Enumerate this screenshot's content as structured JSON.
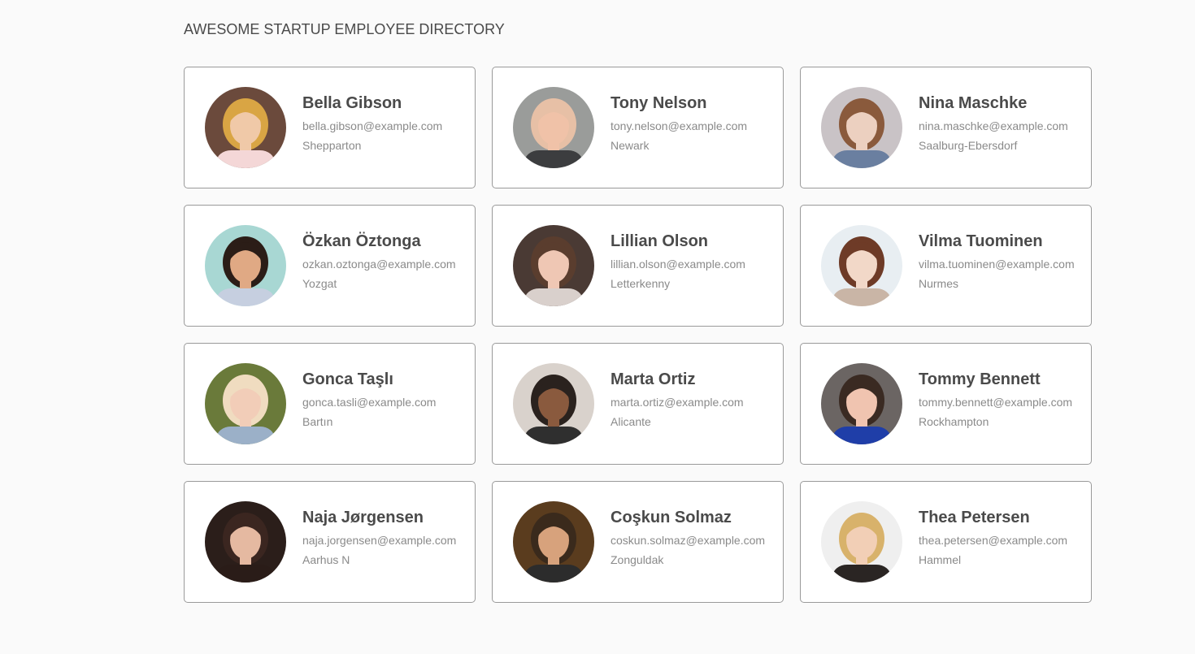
{
  "page": {
    "title": "AWESOME STARTUP EMPLOYEE DIRECTORY"
  },
  "employees": [
    {
      "name": "Bella Gibson",
      "email": "bella.gibson@example.com",
      "city": "Shepparton",
      "avatar": {
        "bg": "#6b4a3c",
        "hair": "#d9a544",
        "skin": "#f0c9a8",
        "shirt": "#f4d7d7"
      }
    },
    {
      "name": "Tony Nelson",
      "email": "tony.nelson@example.com",
      "city": "Newark",
      "avatar": {
        "bg": "#9a9c9a",
        "hair": "#e7c0a6",
        "skin": "#f0c2a8",
        "shirt": "#3c3d3f"
      }
    },
    {
      "name": "Nina Maschke",
      "email": "nina.maschke@example.com",
      "city": "Saalburg-Ebersdorf",
      "avatar": {
        "bg": "#c9c3c6",
        "hair": "#8a5a3c",
        "skin": "#ecd0c0",
        "shirt": "#6a7fa0"
      }
    },
    {
      "name": "Özkan Öztonga",
      "email": "ozkan.oztonga@example.com",
      "city": "Yozgat",
      "avatar": {
        "bg": "#a8d7d3",
        "hair": "#2b1d17",
        "skin": "#e0a984",
        "shirt": "#c6cfe0"
      }
    },
    {
      "name": "Lillian Olson",
      "email": "lillian.olson@example.com",
      "city": "Letterkenny",
      "avatar": {
        "bg": "#4a3a34",
        "hair": "#5a3d2e",
        "skin": "#efc7b4",
        "shirt": "#d9d0cc"
      }
    },
    {
      "name": "Vilma Tuominen",
      "email": "vilma.tuominen@example.com",
      "city": "Nurmes",
      "avatar": {
        "bg": "#e8eef2",
        "hair": "#6e3b27",
        "skin": "#f2d8c8",
        "shirt": "#c9b5a6"
      }
    },
    {
      "name": "Gonca Taşlı",
      "email": "gonca.tasli@example.com",
      "city": "Bartın",
      "avatar": {
        "bg": "#6a7a3a",
        "hair": "#f0dcc0",
        "skin": "#f2cdb8",
        "shirt": "#9bb0c8"
      }
    },
    {
      "name": "Marta Ortiz",
      "email": "marta.ortiz@example.com",
      "city": "Alicante",
      "avatar": {
        "bg": "#d9d2cc",
        "hair": "#2a221e",
        "skin": "#8a5a3e",
        "shirt": "#2f2f2f"
      }
    },
    {
      "name": "Tommy Bennett",
      "email": "tommy.bennett@example.com",
      "city": "Rockhampton",
      "avatar": {
        "bg": "#6b6563",
        "hair": "#3a2a22",
        "skin": "#f0c4b0",
        "shirt": "#1f3ea8"
      }
    },
    {
      "name": "Naja Jørgensen",
      "email": "naja.jorgensen@example.com",
      "city": "Aarhus N",
      "avatar": {
        "bg": "#2b1e1a",
        "hair": "#3b2620",
        "skin": "#e5b9a1",
        "shirt": "#2a1c18"
      }
    },
    {
      "name": "Coşkun Solmaz",
      "email": "coskun.solmaz@example.com",
      "city": "Zonguldak",
      "avatar": {
        "bg": "#5a3c1e",
        "hair": "#3a2a1c",
        "skin": "#d7a27c",
        "shirt": "#2c2c2c"
      }
    },
    {
      "name": "Thea Petersen",
      "email": "thea.petersen@example.com",
      "city": "Hammel",
      "avatar": {
        "bg": "#efefef",
        "hair": "#d8b26b",
        "skin": "#f2cfb6",
        "shirt": "#2a2523"
      }
    }
  ]
}
